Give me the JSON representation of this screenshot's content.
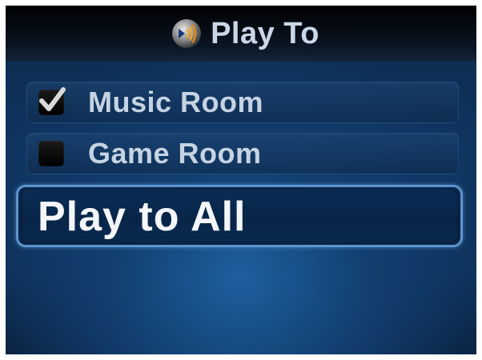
{
  "header": {
    "title": "Play To",
    "icon": "play-to-speaker-icon"
  },
  "devices": [
    {
      "label": "Music Room",
      "checked": true
    },
    {
      "label": "Game Room",
      "checked": false
    }
  ],
  "play_all": {
    "label": "Play to All",
    "selected": true
  },
  "colors": {
    "background": "#0f3460",
    "header": "#000000",
    "text": "#c6d3e3",
    "focus_border": "#5b95cf"
  }
}
